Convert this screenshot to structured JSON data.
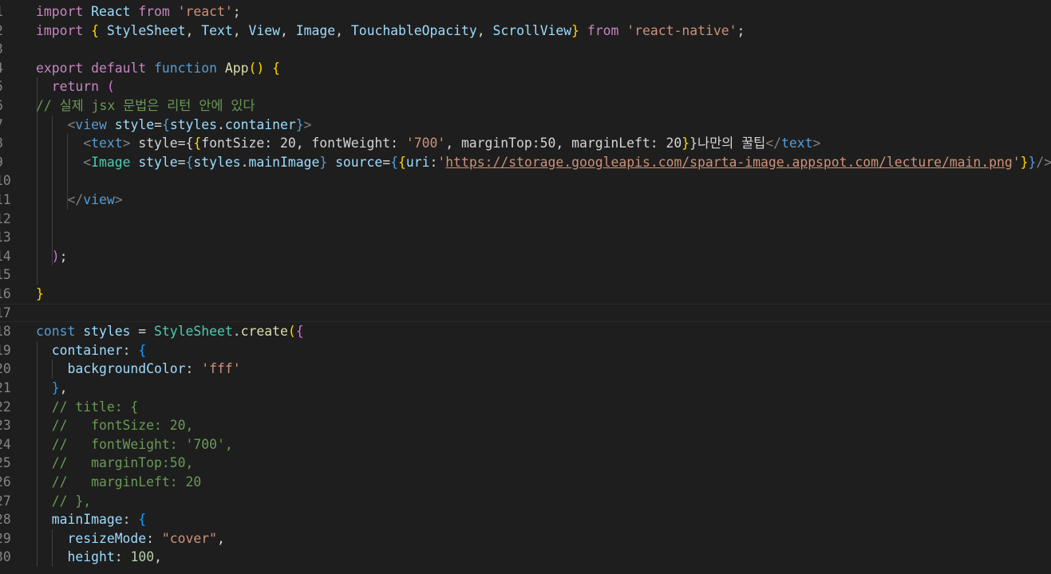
{
  "editor": {
    "language": "javascript",
    "theme_background": "#1e1e1e",
    "current_line": 17,
    "lines": [
      {
        "n": "1",
        "tokens": [
          [
            "kw",
            "import"
          ],
          [
            "pn",
            " "
          ],
          [
            "vr",
            "React"
          ],
          [
            "pn",
            " "
          ],
          [
            "kw",
            "from"
          ],
          [
            "pn",
            " "
          ],
          [
            "st",
            "'react'"
          ],
          [
            "pn",
            ";"
          ]
        ]
      },
      {
        "n": "2",
        "tokens": [
          [
            "kw",
            "import"
          ],
          [
            "pn",
            " "
          ],
          [
            "b1",
            "{"
          ],
          [
            "pn",
            " "
          ],
          [
            "vr",
            "StyleSheet"
          ],
          [
            "pn",
            ", "
          ],
          [
            "vr",
            "Text"
          ],
          [
            "pn",
            ", "
          ],
          [
            "vr",
            "View"
          ],
          [
            "pn",
            ", "
          ],
          [
            "vr",
            "Image"
          ],
          [
            "pn",
            ", "
          ],
          [
            "vr",
            "TouchableOpacity"
          ],
          [
            "pn",
            ", "
          ],
          [
            "vr",
            "ScrollView"
          ],
          [
            "b1",
            "}"
          ],
          [
            "pn",
            " "
          ],
          [
            "kw",
            "from"
          ],
          [
            "pn",
            " "
          ],
          [
            "st",
            "'react-native'"
          ],
          [
            "pn",
            ";"
          ]
        ]
      },
      {
        "n": "3",
        "tokens": []
      },
      {
        "n": "4",
        "tokens": [
          [
            "kw",
            "export"
          ],
          [
            "pn",
            " "
          ],
          [
            "kw",
            "default"
          ],
          [
            "pn",
            " "
          ],
          [
            "kwb",
            "function"
          ],
          [
            "pn",
            " "
          ],
          [
            "fn",
            "App"
          ],
          [
            "b1",
            "()"
          ],
          [
            "pn",
            " "
          ],
          [
            "b1",
            "{"
          ]
        ]
      },
      {
        "n": "5",
        "tokens": [
          [
            "pn",
            "  "
          ],
          [
            "kw",
            "return"
          ],
          [
            "pn",
            " "
          ],
          [
            "b2",
            "("
          ]
        ]
      },
      {
        "n": "6",
        "tokens": [
          [
            "cm",
            "// 실제 jsx 문법은 리턴 안에 있다"
          ]
        ]
      },
      {
        "n": "7",
        "tokens": [
          [
            "pn",
            "    "
          ],
          [
            "tg",
            "<"
          ],
          [
            "tn",
            "view"
          ],
          [
            "pn",
            " "
          ],
          [
            "at",
            "style"
          ],
          [
            "pn",
            "="
          ],
          [
            "kwb",
            "{"
          ],
          [
            "vr",
            "styles"
          ],
          [
            "pn",
            "."
          ],
          [
            "vr",
            "container"
          ],
          [
            "kwb",
            "}"
          ],
          [
            "tg",
            ">"
          ]
        ]
      },
      {
        "n": "8",
        "tokens": [
          [
            "pn",
            "      "
          ],
          [
            "tg",
            "<"
          ],
          [
            "tn",
            "text"
          ],
          [
            "tg",
            ">"
          ],
          [
            "tx",
            " style={"
          ],
          [
            "b1",
            "{"
          ],
          [
            "tx",
            "fontSize: 20, fontWeight: "
          ],
          [
            "st",
            "'700'"
          ],
          [
            "tx",
            ", marginTop:50, marginLeft: 20"
          ],
          [
            "b1",
            "}"
          ],
          [
            "tx",
            "}나만의 꿀팁"
          ],
          [
            "tg",
            "</"
          ],
          [
            "tn",
            "text"
          ],
          [
            "tg",
            ">"
          ]
        ]
      },
      {
        "n": "9",
        "tokens": [
          [
            "pn",
            "      "
          ],
          [
            "tg",
            "<"
          ],
          [
            "tc",
            "Image"
          ],
          [
            "pn",
            " "
          ],
          [
            "at",
            "style"
          ],
          [
            "pn",
            "="
          ],
          [
            "kwb",
            "{"
          ],
          [
            "vr",
            "styles"
          ],
          [
            "pn",
            "."
          ],
          [
            "vr",
            "mainImage"
          ],
          [
            "kwb",
            "}"
          ],
          [
            "pn",
            " "
          ],
          [
            "at",
            "source"
          ],
          [
            "pn",
            "="
          ],
          [
            "kwb",
            "{"
          ],
          [
            "b1",
            "{"
          ],
          [
            "vr",
            "uri"
          ],
          [
            "pn",
            ":"
          ],
          [
            "st",
            "'"
          ],
          [
            "url",
            "https://storage.googleapis.com/sparta-image.appspot.com/lecture/main.png"
          ],
          [
            "st",
            "'"
          ],
          [
            "b1",
            "}"
          ],
          [
            "kwb",
            "}"
          ],
          [
            "tg",
            "/>"
          ]
        ]
      },
      {
        "n": "10",
        "tokens": []
      },
      {
        "n": "11",
        "tokens": [
          [
            "pn",
            "    "
          ],
          [
            "tg",
            "</"
          ],
          [
            "tn",
            "view"
          ],
          [
            "tg",
            ">"
          ]
        ]
      },
      {
        "n": "12",
        "tokens": []
      },
      {
        "n": "13",
        "tokens": []
      },
      {
        "n": "14",
        "tokens": [
          [
            "pn",
            "  "
          ],
          [
            "b2",
            ")"
          ],
          [
            "pn",
            ";"
          ]
        ]
      },
      {
        "n": "15",
        "tokens": []
      },
      {
        "n": "16",
        "tokens": [
          [
            "b1",
            "}"
          ]
        ]
      },
      {
        "n": "17",
        "tokens": []
      },
      {
        "n": "18",
        "tokens": [
          [
            "kwb",
            "const"
          ],
          [
            "pn",
            " "
          ],
          [
            "vr",
            "styles"
          ],
          [
            "pn",
            " = "
          ],
          [
            "ty",
            "StyleSheet"
          ],
          [
            "pn",
            "."
          ],
          [
            "fn",
            "create"
          ],
          [
            "b1",
            "("
          ],
          [
            "b2",
            "{"
          ]
        ]
      },
      {
        "n": "19",
        "tokens": [
          [
            "pn",
            "  "
          ],
          [
            "vr",
            "container"
          ],
          [
            "pn",
            ": "
          ],
          [
            "b3",
            "{"
          ]
        ]
      },
      {
        "n": "20",
        "tokens": [
          [
            "pn",
            "    "
          ],
          [
            "vr",
            "backgroundColor"
          ],
          [
            "pn",
            ": "
          ],
          [
            "st",
            "'fff'"
          ]
        ]
      },
      {
        "n": "21",
        "tokens": [
          [
            "pn",
            "  "
          ],
          [
            "b3",
            "}"
          ],
          [
            "pn",
            ","
          ]
        ]
      },
      {
        "n": "22",
        "tokens": [
          [
            "pn",
            "  "
          ],
          [
            "cm",
            "// title: {"
          ]
        ]
      },
      {
        "n": "23",
        "tokens": [
          [
            "pn",
            "  "
          ],
          [
            "cm",
            "//   fontSize: 20,"
          ]
        ]
      },
      {
        "n": "24",
        "tokens": [
          [
            "pn",
            "  "
          ],
          [
            "cm",
            "//   fontWeight: '700',"
          ]
        ]
      },
      {
        "n": "25",
        "tokens": [
          [
            "pn",
            "  "
          ],
          [
            "cm",
            "//   marginTop:50,"
          ]
        ]
      },
      {
        "n": "26",
        "tokens": [
          [
            "pn",
            "  "
          ],
          [
            "cm",
            "//   marginLeft: 20"
          ]
        ]
      },
      {
        "n": "27",
        "tokens": [
          [
            "pn",
            "  "
          ],
          [
            "cm",
            "// },"
          ]
        ]
      },
      {
        "n": "28",
        "tokens": [
          [
            "pn",
            "  "
          ],
          [
            "vr",
            "mainImage"
          ],
          [
            "pn",
            ": "
          ],
          [
            "b3",
            "{"
          ]
        ]
      },
      {
        "n": "29",
        "tokens": [
          [
            "pn",
            "    "
          ],
          [
            "vr",
            "resizeMode"
          ],
          [
            "pn",
            ": "
          ],
          [
            "st",
            "\"cover\""
          ],
          [
            "pn",
            ","
          ]
        ]
      },
      {
        "n": "30",
        "tokens": [
          [
            "pn",
            "    "
          ],
          [
            "vr",
            "height"
          ],
          [
            "pn",
            ": "
          ],
          [
            "nm",
            "100"
          ],
          [
            "pn",
            ","
          ]
        ]
      }
    ]
  }
}
